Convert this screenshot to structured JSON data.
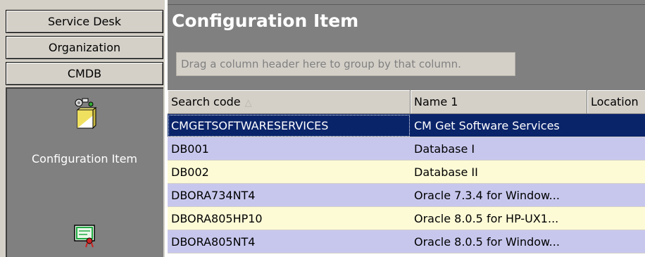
{
  "nav": {
    "buttons": [
      {
        "label": "Service Desk"
      },
      {
        "label": "Organization"
      },
      {
        "label": "CMDB"
      }
    ],
    "items": [
      {
        "label": "Configuration Item",
        "icon": "configuration-item-icon"
      },
      {
        "label": "",
        "icon": "contract-certificate-icon"
      }
    ]
  },
  "main": {
    "title": "Configuration Item",
    "group_hint": "Drag a column header here to group by that column.",
    "columns": [
      {
        "label": "Search code",
        "sort": "△"
      },
      {
        "label": "Name 1",
        "sort": ""
      },
      {
        "label": "Location",
        "sort": ""
      }
    ],
    "rows": [
      {
        "code": "CMGETSOFTWARESERVICES",
        "name": "CM Get Software Services",
        "location": ""
      },
      {
        "code": "DB001",
        "name": "Database I",
        "location": ""
      },
      {
        "code": "DB002",
        "name": "Database II",
        "location": ""
      },
      {
        "code": "DBORA734NT4",
        "name": "Oracle 7.3.4 for Window...",
        "location": ""
      },
      {
        "code": "DBORA805HP10",
        "name": "Oracle 8.0.5 for HP-UX1...",
        "location": ""
      },
      {
        "code": "DBORA805NT4",
        "name": "Oracle 8.0.5 for Window...",
        "location": ""
      }
    ]
  },
  "colors": {
    "selection": "#0a246a",
    "row_lavender": "#c7c7ee",
    "row_yellow": "#fdfbd6",
    "panel_gray": "#808080",
    "chrome": "#d4d0c8"
  }
}
